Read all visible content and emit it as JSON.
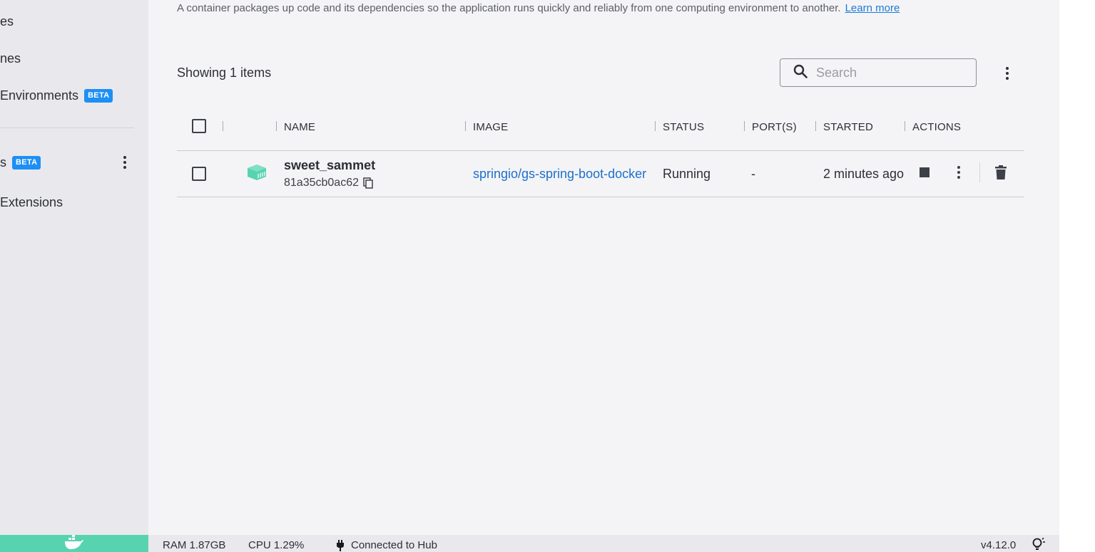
{
  "sidebar": {
    "items": [
      {
        "label": "es"
      },
      {
        "label": "nes"
      },
      {
        "label": "Environments",
        "badge": "BETA"
      },
      {
        "label": "s",
        "badge": "BETA"
      },
      {
        "label": "Extensions"
      }
    ]
  },
  "main": {
    "description": "A container packages up code and its dependencies so the application runs quickly and reliably from one computing environment to another.",
    "learn_more": "Learn more",
    "showing": "Showing 1 items",
    "search": {
      "placeholder": "Search"
    }
  },
  "table": {
    "headers": {
      "name": "NAME",
      "image": "IMAGE",
      "status": "STATUS",
      "ports": "PORT(S)",
      "started": "STARTED",
      "actions": "ACTIONS"
    },
    "rows": [
      {
        "name": "sweet_sammet",
        "id": "81a35cb0ac62",
        "image": "springio/gs-spring-boot-docker",
        "status": "Running",
        "ports": "-",
        "started": "2 minutes ago"
      }
    ]
  },
  "statusbar": {
    "ram": "RAM 1.87GB",
    "cpu": "CPU 1.29%",
    "hub": "Connected to Hub",
    "version": "v4.12.0"
  },
  "colors": {
    "accent": "#1d8ff5",
    "link": "#1d6fce",
    "running": "#58d3b0"
  },
  "icons": [
    "search-icon",
    "kebab-icon",
    "container-icon",
    "copy-icon",
    "stop-icon",
    "delete-icon",
    "whale-icon",
    "plug-icon",
    "bulb-icon"
  ]
}
